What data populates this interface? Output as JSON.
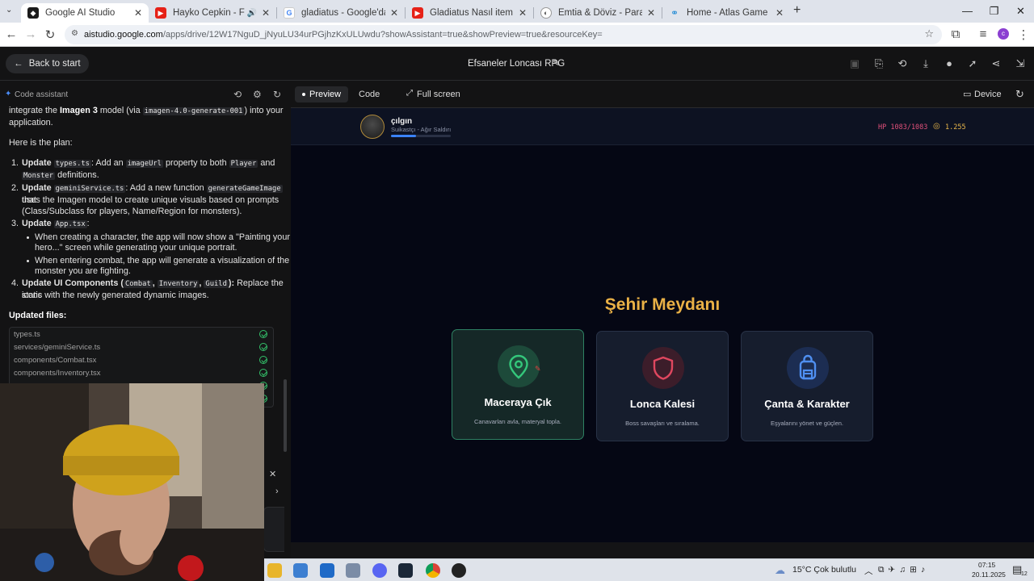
{
  "browser": {
    "tabs": [
      {
        "title": "Google AI Studio",
        "active": true
      },
      {
        "title": "Hayko Cepkin - Fırtınam - Y",
        "active": false
      },
      {
        "title": "gladiatus - Google'da Ara",
        "active": false
      },
      {
        "title": "Gladiatus Nasıl item kombini ya",
        "active": false
      },
      {
        "title": "Emtia & Döviz - Paralika",
        "active": false
      },
      {
        "title": "Home - Atlas Game",
        "active": false
      }
    ],
    "new_tab": "+",
    "url_host": "aistudio.google.com",
    "url_rest": "/apps/drive/12W17NguD_jNyuLU34urPGjhzKxULUwdu?showAssistant=true&showPreview=true&resourceKey="
  },
  "app": {
    "back_label": "Back to start",
    "project_title": "Efsaneler Loncası RPG"
  },
  "assistant": {
    "label": "Code assistant",
    "intro_pre": "integrate the ",
    "intro_bold": "Imagen 3",
    "intro_mid": " model (via ",
    "intro_code": "imagen-4.0-generate-001",
    "intro_post": ") into your",
    "intro_line2": "application.",
    "plan_heading": "Here is the plan:",
    "step1_bold": "Update ",
    "step1_code": "types.ts",
    "step1_text": ": Add an ",
    "step1_code2": "imageUrl",
    "step1_text2": " property to both ",
    "step1_code3": "Player",
    "step1_text3": " and",
    "step1_code4": "Monster",
    "step1_text4": " definitions.",
    "step2_bold": "Update ",
    "step2_code": "geminiService.ts",
    "step2_text": ": Add a new function ",
    "step2_code2": "generateGameImage",
    "step2_text2": " that",
    "step2_line2": "uses the Imagen model to create unique visuals based on prompts",
    "step2_line3": "(Class/Subclass for players, Name/Region for monsters).",
    "step3_bold": "Update ",
    "step3_code": "App.tsx",
    "step3_text": ":",
    "bullet1_line1": "When creating a character, the app will now show a \"Painting your",
    "bullet1_line2": "hero...\" screen while generating your unique portrait.",
    "bullet2_line1": "When entering combat, the app will generate a visualization of the",
    "bullet2_line2": "monster you are fighting.",
    "step4_bold": "Update UI Components (",
    "step4_code1": "Combat",
    "step4_code2": "Inventory",
    "step4_code3": "Guild",
    "step4_bold2": "):",
    "step4_text": " Replace the static",
    "step4_line2": "icons with the newly generated dynamic images.",
    "updated_files_label": "Updated files:",
    "files": [
      "types.ts",
      "services/geminiService.ts",
      "components/Combat.tsx",
      "components/Inventory.tsx"
    ]
  },
  "preview": {
    "tabs": {
      "preview": "Preview",
      "code": "Code",
      "fullscreen": "Full screen",
      "device": "Device"
    }
  },
  "game": {
    "player_name": "çılgın",
    "player_class": "Suikastçı - Ağır Saldırı",
    "xp_fraction": 0.42,
    "hp_text": "HP 1083/1083",
    "gold_text": "1.255",
    "scene_title": "Şehir Meydanı",
    "cards": [
      {
        "title": "Maceraya Çık",
        "desc": "Canavarları avla, materyal topla.",
        "icon": "map-pin-icon",
        "color": "#34c77b"
      },
      {
        "title": "Lonca Kalesi",
        "desc": "Boss savaşları ve sıralama.",
        "icon": "shield-icon",
        "color": "#e0475f"
      },
      {
        "title": "Çanta & Karakter",
        "desc": "Eşyalarını yönet ve güçlen.",
        "icon": "backpack-icon",
        "color": "#4f8ff0"
      }
    ]
  },
  "taskbar": {
    "weather": "15°C  Çok bulutlu",
    "time": "07:15",
    "date": "20.11.2025",
    "notif_count": "12"
  }
}
